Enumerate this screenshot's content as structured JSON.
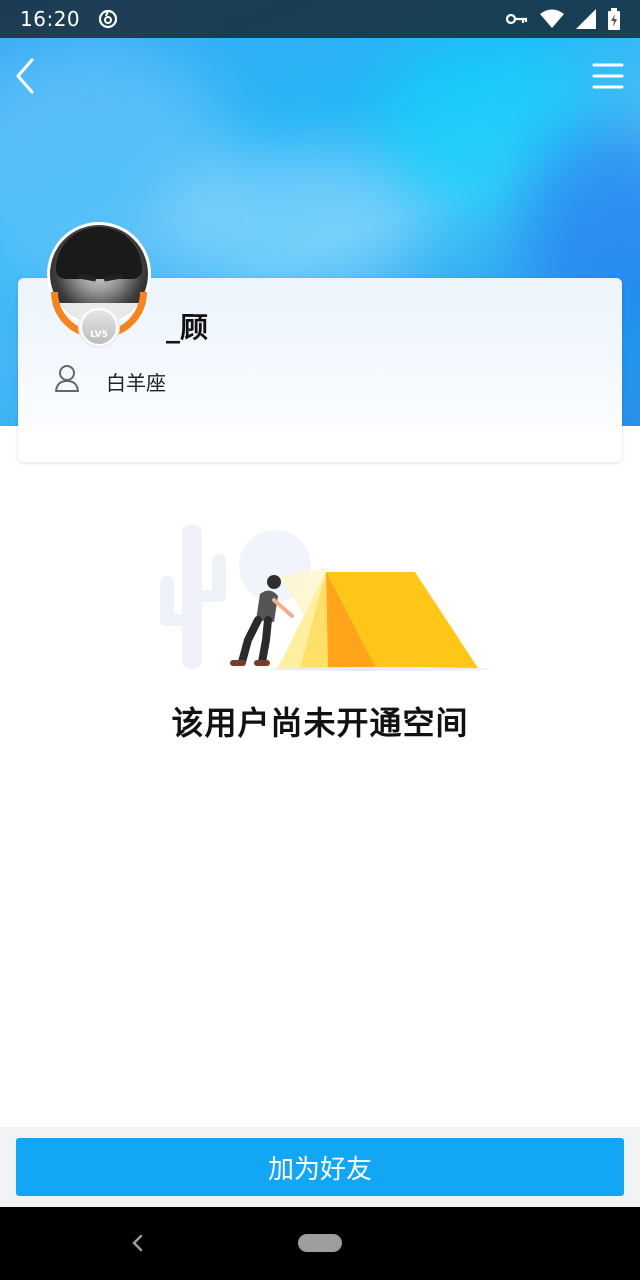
{
  "status_bar": {
    "time": "16:20",
    "icons": [
      "netease-music-icon",
      "vpn-key-icon",
      "wifi-icon",
      "signal-icon",
      "battery-icon"
    ]
  },
  "nav": {
    "back_icon": "chevron-left-icon",
    "menu_icon": "hamburger-menu-icon"
  },
  "profile": {
    "username": "_顾",
    "constellation": "白羊座",
    "level_badge": "LV5",
    "avatar_frame_color": "#f5841f"
  },
  "empty_state": {
    "illustration": "person-pitching-tent-illustration",
    "message": "该用户尚未开通空间"
  },
  "actions": {
    "add_friend_label": "加为好友",
    "button_color": "#12a6f5"
  }
}
